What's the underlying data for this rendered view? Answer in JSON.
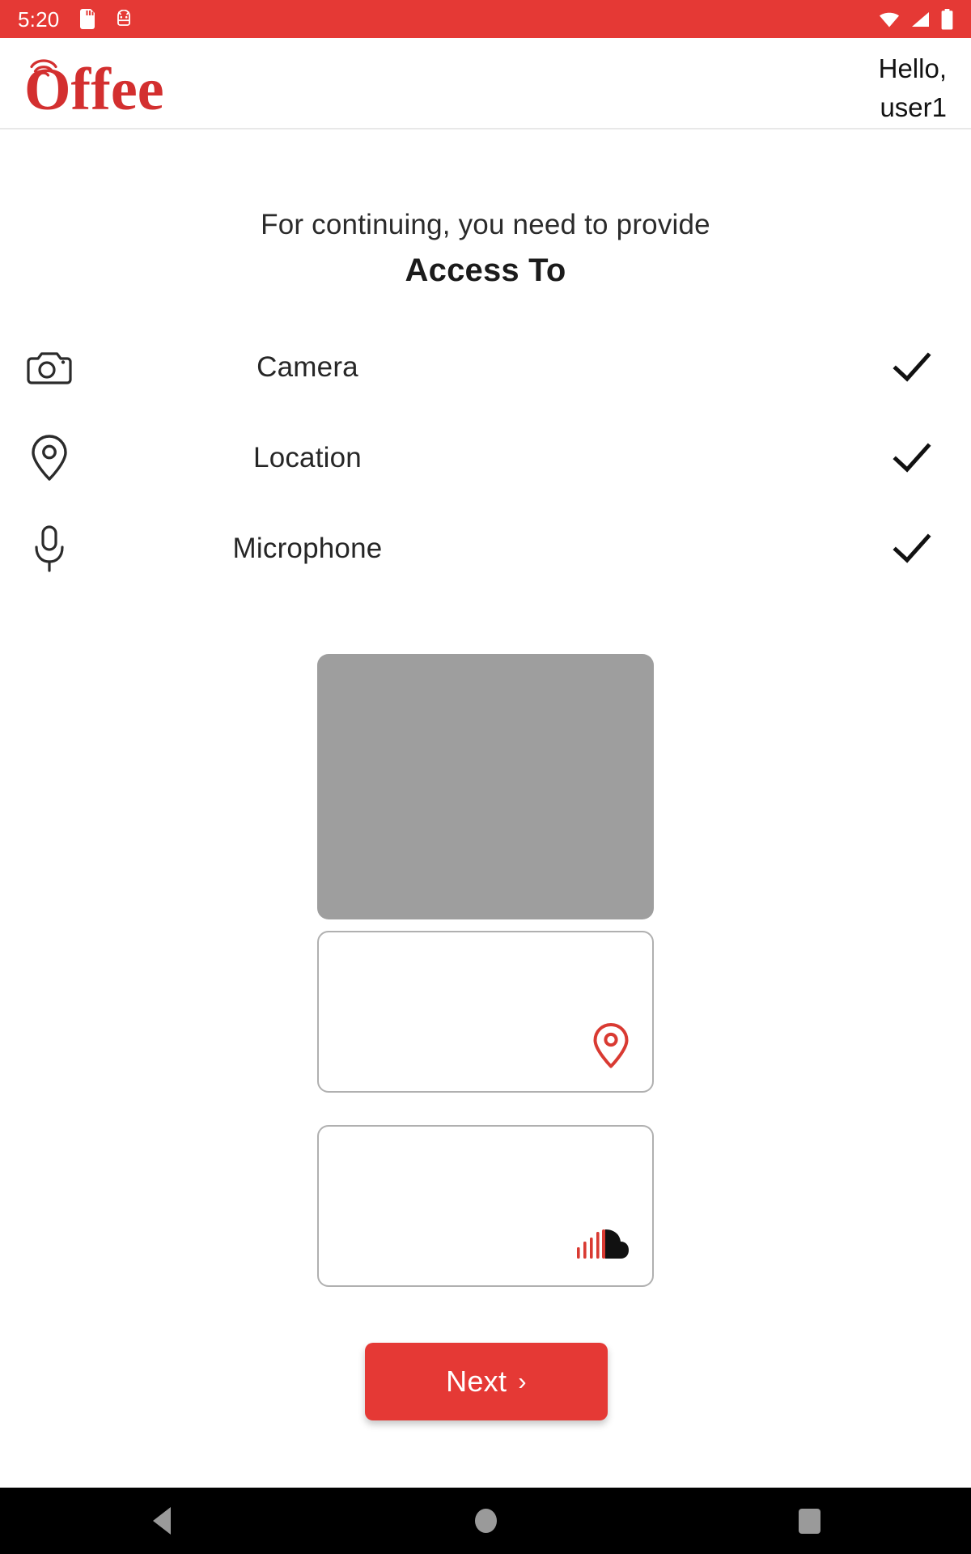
{
  "status_bar": {
    "time": "5:20",
    "left_icons": [
      "sd-card-icon",
      "android-icon"
    ],
    "right_icons": [
      "wifi-icon",
      "cellular-signal-icon",
      "battery-icon"
    ],
    "background_color": "#e53935"
  },
  "app_bar": {
    "logo_text": "Offee",
    "logo_icon": "wifi-arc-icon",
    "logo_color": "#d32f2f",
    "greeting_line1": "Hello,",
    "greeting_line2": "user1"
  },
  "headings": {
    "subtitle": "For continuing, you need to provide",
    "title": "Access To"
  },
  "permissions": [
    {
      "icon": "camera-icon",
      "label": "Camera",
      "granted": true,
      "check_icon": "checkmark-icon"
    },
    {
      "icon": "location-pin-icon",
      "label": "Location",
      "granted": true,
      "check_icon": "checkmark-icon"
    },
    {
      "icon": "microphone-icon",
      "label": "Microphone",
      "granted": true,
      "check_icon": "checkmark-icon"
    }
  ],
  "previews": {
    "camera_preview": {
      "name": "camera-preview-box",
      "fill_color": "#9e9e9e"
    },
    "location_card": {
      "name": "location-preview-card",
      "icon": "location-pin-icon",
      "icon_color": "#d93a32"
    },
    "microphone_card": {
      "name": "microphone-preview-card",
      "icon": "soundcloud-audio-icon",
      "icon_color": "#d93a32"
    }
  },
  "next_button": {
    "label": "Next",
    "chevron": "›",
    "background_color": "#e53935",
    "text_color": "#ffffff"
  },
  "nav_bar": {
    "back": "back-icon",
    "home": "home-icon",
    "recents": "recents-icon",
    "background_color": "#000000",
    "icon_color": "#9a9a9a"
  }
}
